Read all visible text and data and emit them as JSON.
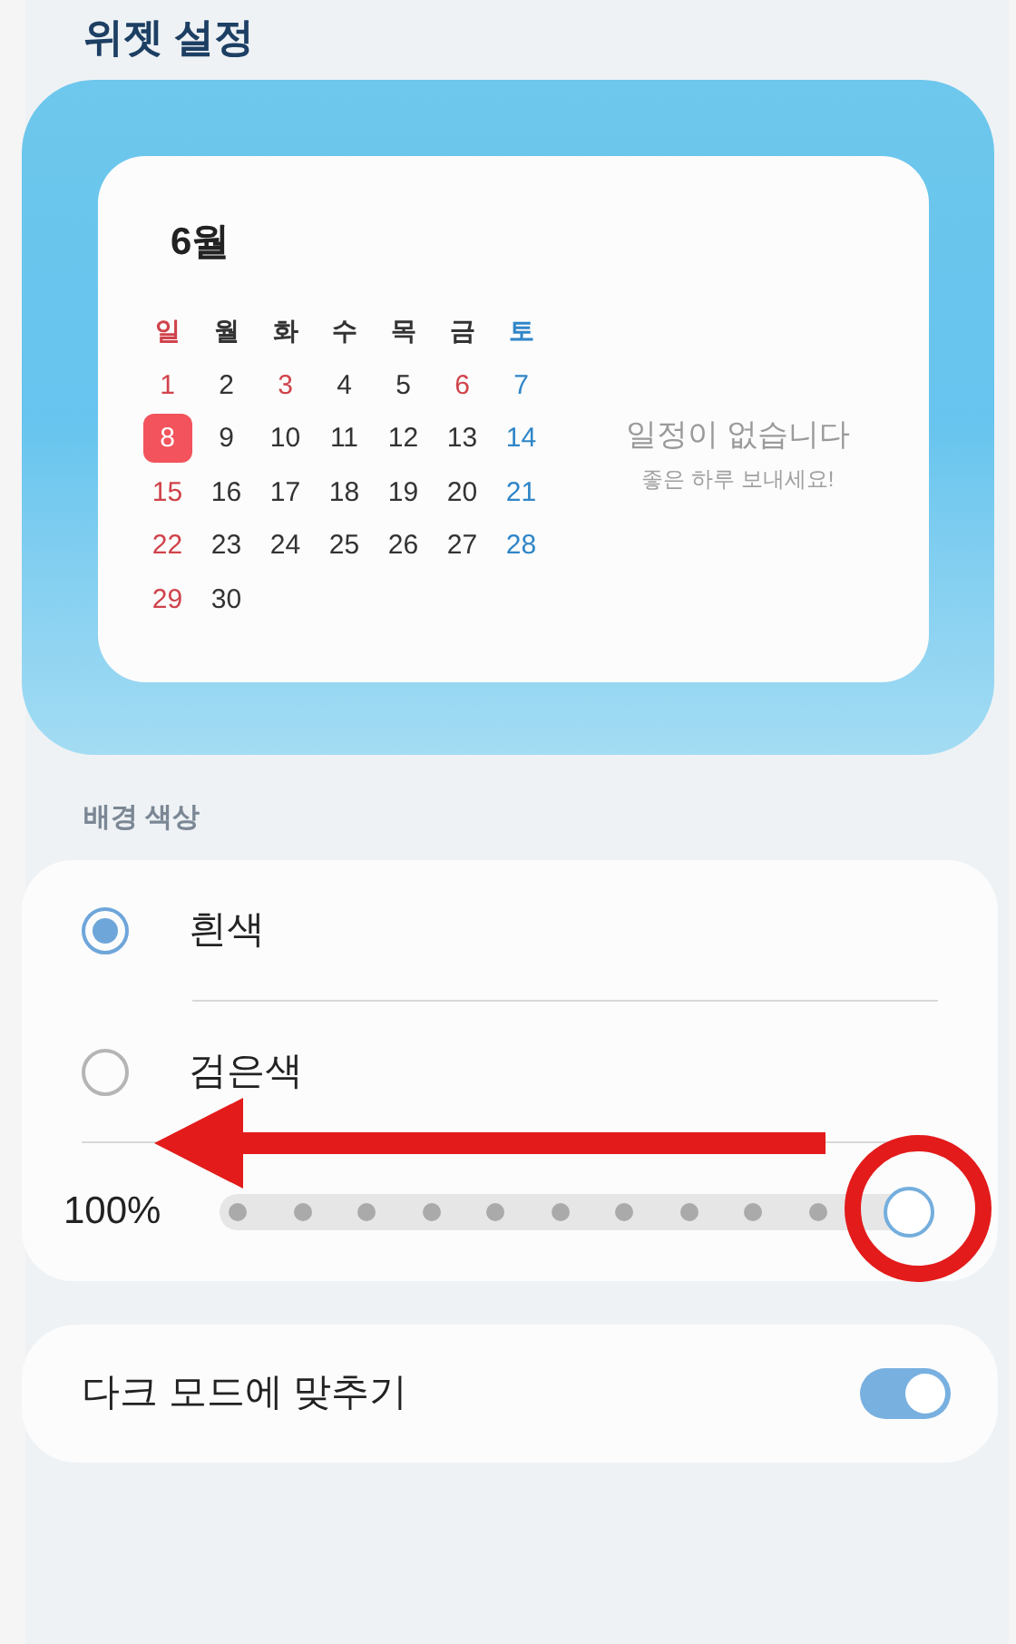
{
  "header": {
    "title": "위젯 설정"
  },
  "widget_preview": {
    "month": "6월",
    "weekdays": [
      {
        "label": "일",
        "kind": "sun"
      },
      {
        "label": "월",
        "kind": "normal"
      },
      {
        "label": "화",
        "kind": "normal"
      },
      {
        "label": "수",
        "kind": "normal"
      },
      {
        "label": "목",
        "kind": "normal"
      },
      {
        "label": "금",
        "kind": "normal"
      },
      {
        "label": "토",
        "kind": "sat"
      }
    ],
    "weeks": [
      [
        {
          "label": "1",
          "kind": "sun"
        },
        {
          "label": "2",
          "kind": "normal"
        },
        {
          "label": "3",
          "kind": "holiday"
        },
        {
          "label": "4",
          "kind": "normal"
        },
        {
          "label": "5",
          "kind": "normal"
        },
        {
          "label": "6",
          "kind": "holiday"
        },
        {
          "label": "7",
          "kind": "sat"
        }
      ],
      [
        {
          "label": "8",
          "kind": "today"
        },
        {
          "label": "9",
          "kind": "normal"
        },
        {
          "label": "10",
          "kind": "normal"
        },
        {
          "label": "11",
          "kind": "normal"
        },
        {
          "label": "12",
          "kind": "normal"
        },
        {
          "label": "13",
          "kind": "normal"
        },
        {
          "label": "14",
          "kind": "sat"
        }
      ],
      [
        {
          "label": "15",
          "kind": "sun"
        },
        {
          "label": "16",
          "kind": "normal"
        },
        {
          "label": "17",
          "kind": "normal"
        },
        {
          "label": "18",
          "kind": "normal"
        },
        {
          "label": "19",
          "kind": "normal"
        },
        {
          "label": "20",
          "kind": "normal"
        },
        {
          "label": "21",
          "kind": "sat"
        }
      ],
      [
        {
          "label": "22",
          "kind": "sun"
        },
        {
          "label": "23",
          "kind": "normal"
        },
        {
          "label": "24",
          "kind": "normal"
        },
        {
          "label": "25",
          "kind": "normal"
        },
        {
          "label": "26",
          "kind": "normal"
        },
        {
          "label": "27",
          "kind": "normal"
        },
        {
          "label": "28",
          "kind": "sat"
        }
      ],
      [
        {
          "label": "29",
          "kind": "sun"
        },
        {
          "label": "30",
          "kind": "normal"
        }
      ]
    ],
    "empty_title": "일정이 없습니다",
    "empty_subtitle": "좋은 하루 보내세요!"
  },
  "background_color": {
    "label": "배경 색상",
    "options": [
      {
        "label": "흰색",
        "selected": true
      },
      {
        "label": "검은색",
        "selected": false
      }
    ],
    "transparency": {
      "reading": "100%",
      "level": 1.0
    }
  },
  "dark_mode": {
    "label": "다크 모드에 맞추기",
    "on": true
  }
}
